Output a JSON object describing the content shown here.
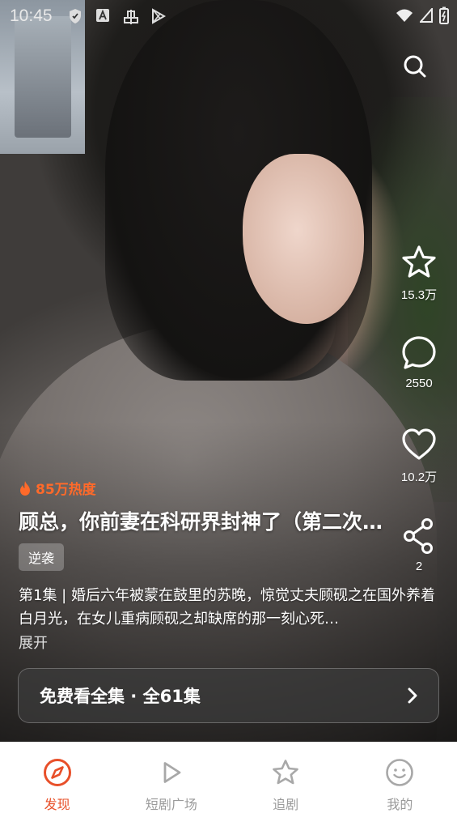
{
  "status_bar": {
    "time": "10:45"
  },
  "video": {
    "heat": "85万热度",
    "title": "顾总，你前妻在科研界封神了（第二次…",
    "tag": "逆袭",
    "description": "第1集 | 婚后六年被蒙在鼓里的苏晚，惊觉丈夫顾砚之在国外养着白月光，在女儿重病顾砚之却缺席的那一刻心死…",
    "expand_label": "展开",
    "watch_button": "免费看全集 · 全61集"
  },
  "actions": {
    "favorite_count": "15.3万",
    "comment_count": "2550",
    "like_count": "10.2万",
    "share_count": "2"
  },
  "bottom_nav": {
    "items": [
      {
        "label": "发现",
        "icon": "compass-icon",
        "active": true
      },
      {
        "label": "短剧广场",
        "icon": "play-icon",
        "active": false
      },
      {
        "label": "追剧",
        "icon": "star-icon",
        "active": false
      },
      {
        "label": "我的",
        "icon": "smiley-icon",
        "active": false
      }
    ]
  },
  "colors": {
    "accent": "#e8502a",
    "heat": "#ff6a2a"
  }
}
